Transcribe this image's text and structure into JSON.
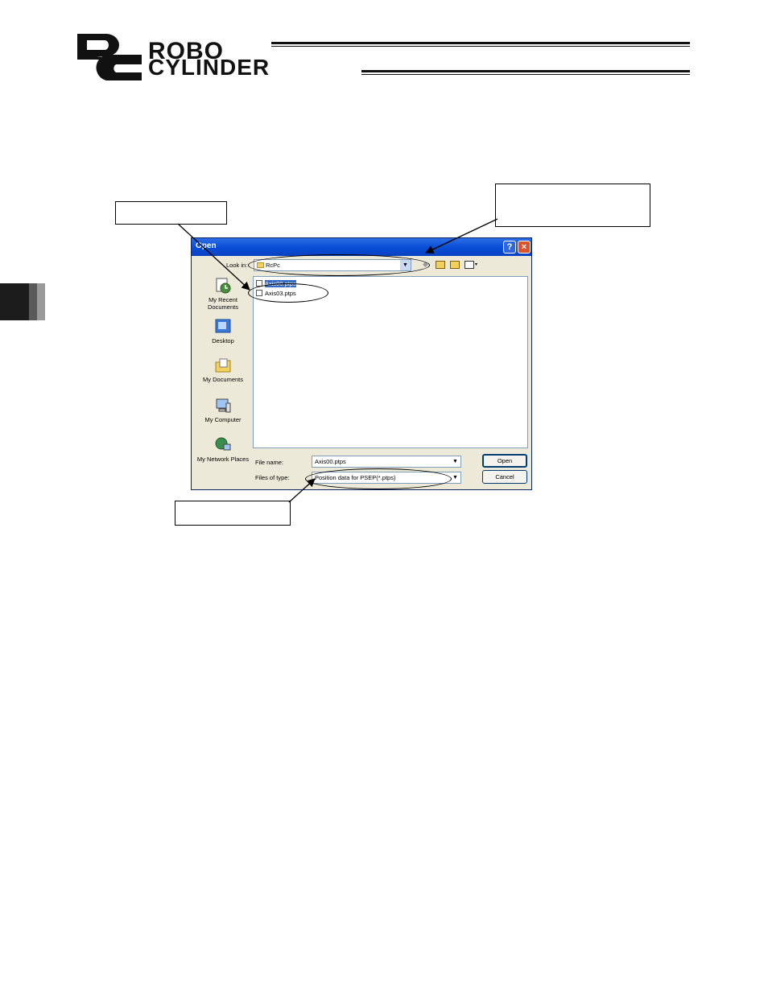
{
  "header": {
    "logo_mark": "RC",
    "line1": "ROBO",
    "line2": "CYLINDER"
  },
  "dialog": {
    "title": "Open",
    "look_in_label": "Look in:",
    "look_in_value": "RcPc",
    "files": [
      {
        "name": "Axis00.ptps",
        "selected": true
      },
      {
        "name": "Axis03.ptps",
        "selected": false
      }
    ],
    "places": [
      {
        "label": "My Recent Documents",
        "icon": "recent-documents-icon"
      },
      {
        "label": "Desktop",
        "icon": "desktop-icon"
      },
      {
        "label": "My Documents",
        "icon": "my-documents-icon"
      },
      {
        "label": "My Computer",
        "icon": "my-computer-icon"
      },
      {
        "label": "My Network Places",
        "icon": "network-places-icon"
      }
    ],
    "file_name_label": "File name:",
    "file_name_value": "Axis00.ptps",
    "file_type_label": "Files of type:",
    "file_type_value": "Position data for PSEP(*.ptps)",
    "open_label": "Open",
    "cancel_label": "Cancel",
    "help_label": "?",
    "close_label": "×"
  },
  "colors": {
    "titlebar": "#0a4fd6",
    "dialog_bg": "#ece9d8",
    "selection": "#316ac5"
  }
}
